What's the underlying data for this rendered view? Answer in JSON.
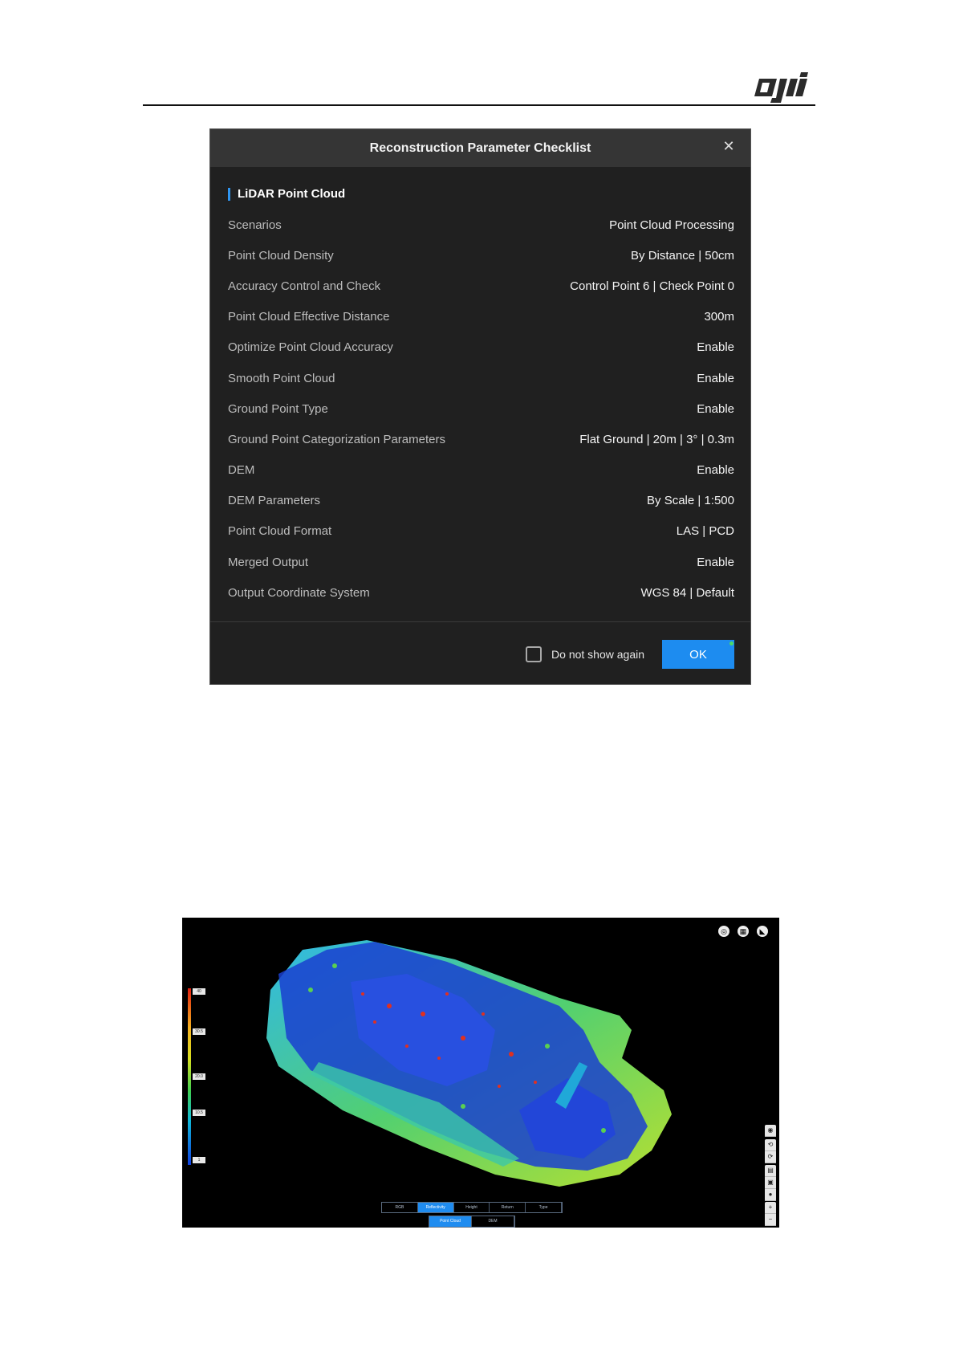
{
  "brand": {
    "logo_text": "dji"
  },
  "dialog": {
    "title": "Reconstruction Parameter Checklist",
    "close_icon": "close-icon",
    "section_title": "LiDAR Point Cloud",
    "rows": [
      {
        "label": "Scenarios",
        "value": "Point Cloud Processing"
      },
      {
        "label": "Point Cloud Density",
        "value": "By Distance  |  50cm"
      },
      {
        "label": "Accuracy Control and Check",
        "value": "Control Point 6  |  Check Point 0"
      },
      {
        "label": "Point Cloud Effective Distance",
        "value": "300m"
      },
      {
        "label": "Optimize Point Cloud Accuracy",
        "value": "Enable"
      },
      {
        "label": "Smooth Point Cloud",
        "value": "Enable"
      },
      {
        "label": "Ground Point Type",
        "value": "Enable"
      },
      {
        "label": "Ground Point Categorization Parameters",
        "value": "Flat Ground  |  20m  |  3°  |  0.3m"
      },
      {
        "label": "DEM",
        "value": "Enable"
      },
      {
        "label": "DEM Parameters",
        "value": "By Scale  |  1:500"
      },
      {
        "label": "Point Cloud Format",
        "value": "LAS  |  PCD"
      },
      {
        "label": "Merged Output",
        "value": "Enable"
      },
      {
        "label": "Output Coordinate System",
        "value": "WGS 84  |  Default"
      }
    ],
    "checkbox_label": "Do not show again",
    "checkbox_checked": false,
    "ok_label": "OK",
    "accent": "#1d8cf0"
  },
  "viewer": {
    "legend_ticks": [
      "40",
      "30.5",
      "20.0",
      "10.5",
      "1"
    ],
    "top_tools": [
      "layers-icon",
      "grid-icon",
      "measure-icon"
    ],
    "right_tools": [
      "view-icon",
      "orbit-icon",
      "rotate-icon",
      "layer-icon",
      "cube-icon",
      "sphere-icon",
      "zoom-in-icon",
      "zoom-out-icon"
    ],
    "zoom_in": "+",
    "zoom_out": "−",
    "color_tabs": [
      "RGB",
      "Reflectivity",
      "Height",
      "Return",
      "Type"
    ],
    "color_tab_active": 1,
    "mode_tabs": [
      "Point Cloud",
      "DEM"
    ],
    "mode_tab_active": 0
  }
}
